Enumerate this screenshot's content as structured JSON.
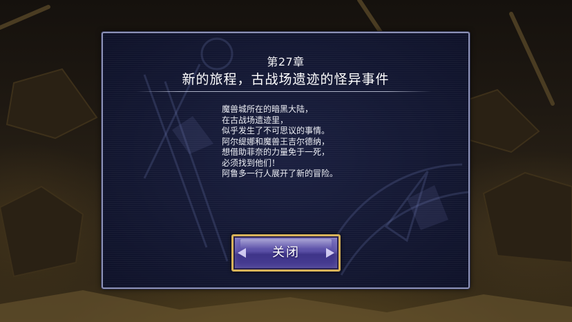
{
  "dialog": {
    "chapter": "第27章",
    "title": "新的旅程，古战场遗迹的怪异事件",
    "story_lines": [
      "魔兽城所在的暗黑大陆，",
      "在古战场遗迹里，",
      "似乎发生了不可思议的事情。",
      "阿尔缇娜和魔兽王吉尔德纳，",
      "想借助菲奈的力量免于一死，",
      "必须找到他们！",
      "阿鲁多一行人展开了新的冒险。"
    ],
    "close_label": "关闭"
  },
  "colors": {
    "panel_border": "#8d92b8",
    "panel_bg": "#121630",
    "button_border": "#d8b35a",
    "button_fill": "#5a4fa6"
  },
  "icons": {
    "button_left": "arrow-left-icon",
    "button_right": "arrow-right-icon"
  }
}
